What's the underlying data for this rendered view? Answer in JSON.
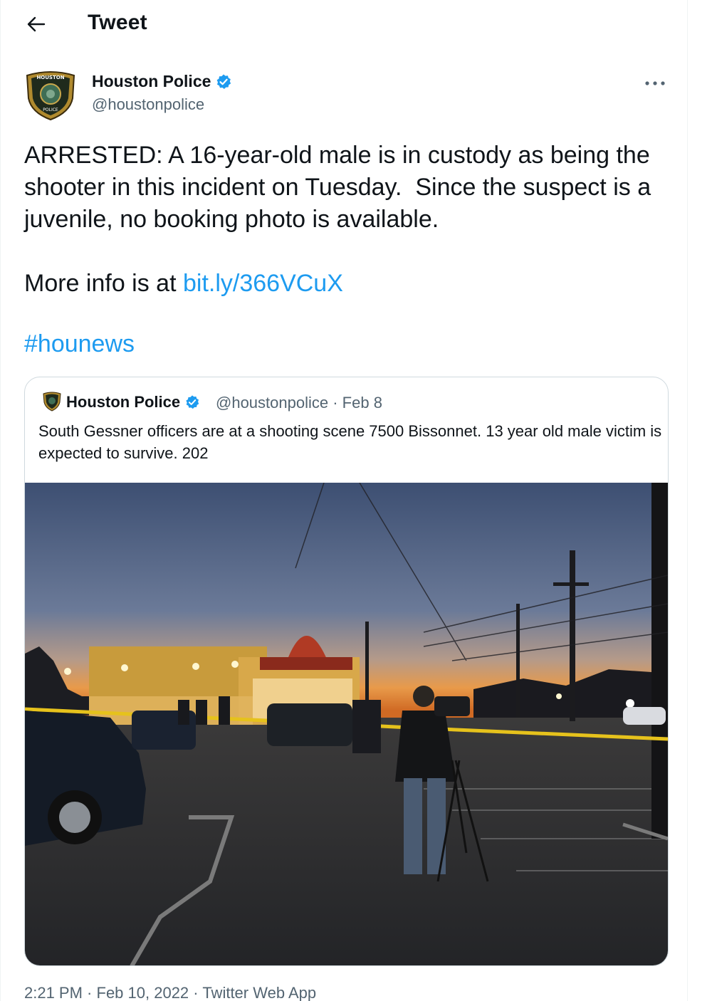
{
  "header": {
    "title": "Tweet"
  },
  "author": {
    "name": "Houston Police",
    "handle": "@houstonpolice",
    "verified": true,
    "avatar_badge_top": "HOUSTON",
    "avatar_badge_bottom": "POLICE"
  },
  "tweet": {
    "line1": "ARRESTED: A 16-year-old male is in custody as being the shooter in this incident on Tuesday.  Since the suspect is a juvenile, no booking photo is available.",
    "more_info_prefix": "More info is at ",
    "link": "bit.ly/366VCuX",
    "hashtag": "#hounews"
  },
  "quoted": {
    "name": "Houston Police",
    "handle": "@houstonpolice",
    "separator": " · ",
    "date": "Feb 8",
    "text": "South Gessner officers are at a shooting scene 7500 Bissonnet. 13 year old male victim is expected to survive. 202"
  },
  "footer": {
    "time": "2:21 PM",
    "sep1": " · ",
    "date": "Feb 10, 2022",
    "sep2": " · ",
    "source": "Twitter Web App"
  },
  "colors": {
    "accent": "#1d9bf0",
    "secondary_text": "#536471",
    "border": "#cfd9de"
  },
  "icons": {
    "back": "arrow-left-icon",
    "verified": "verified-badge-icon",
    "more": "more-horizontal-icon"
  }
}
